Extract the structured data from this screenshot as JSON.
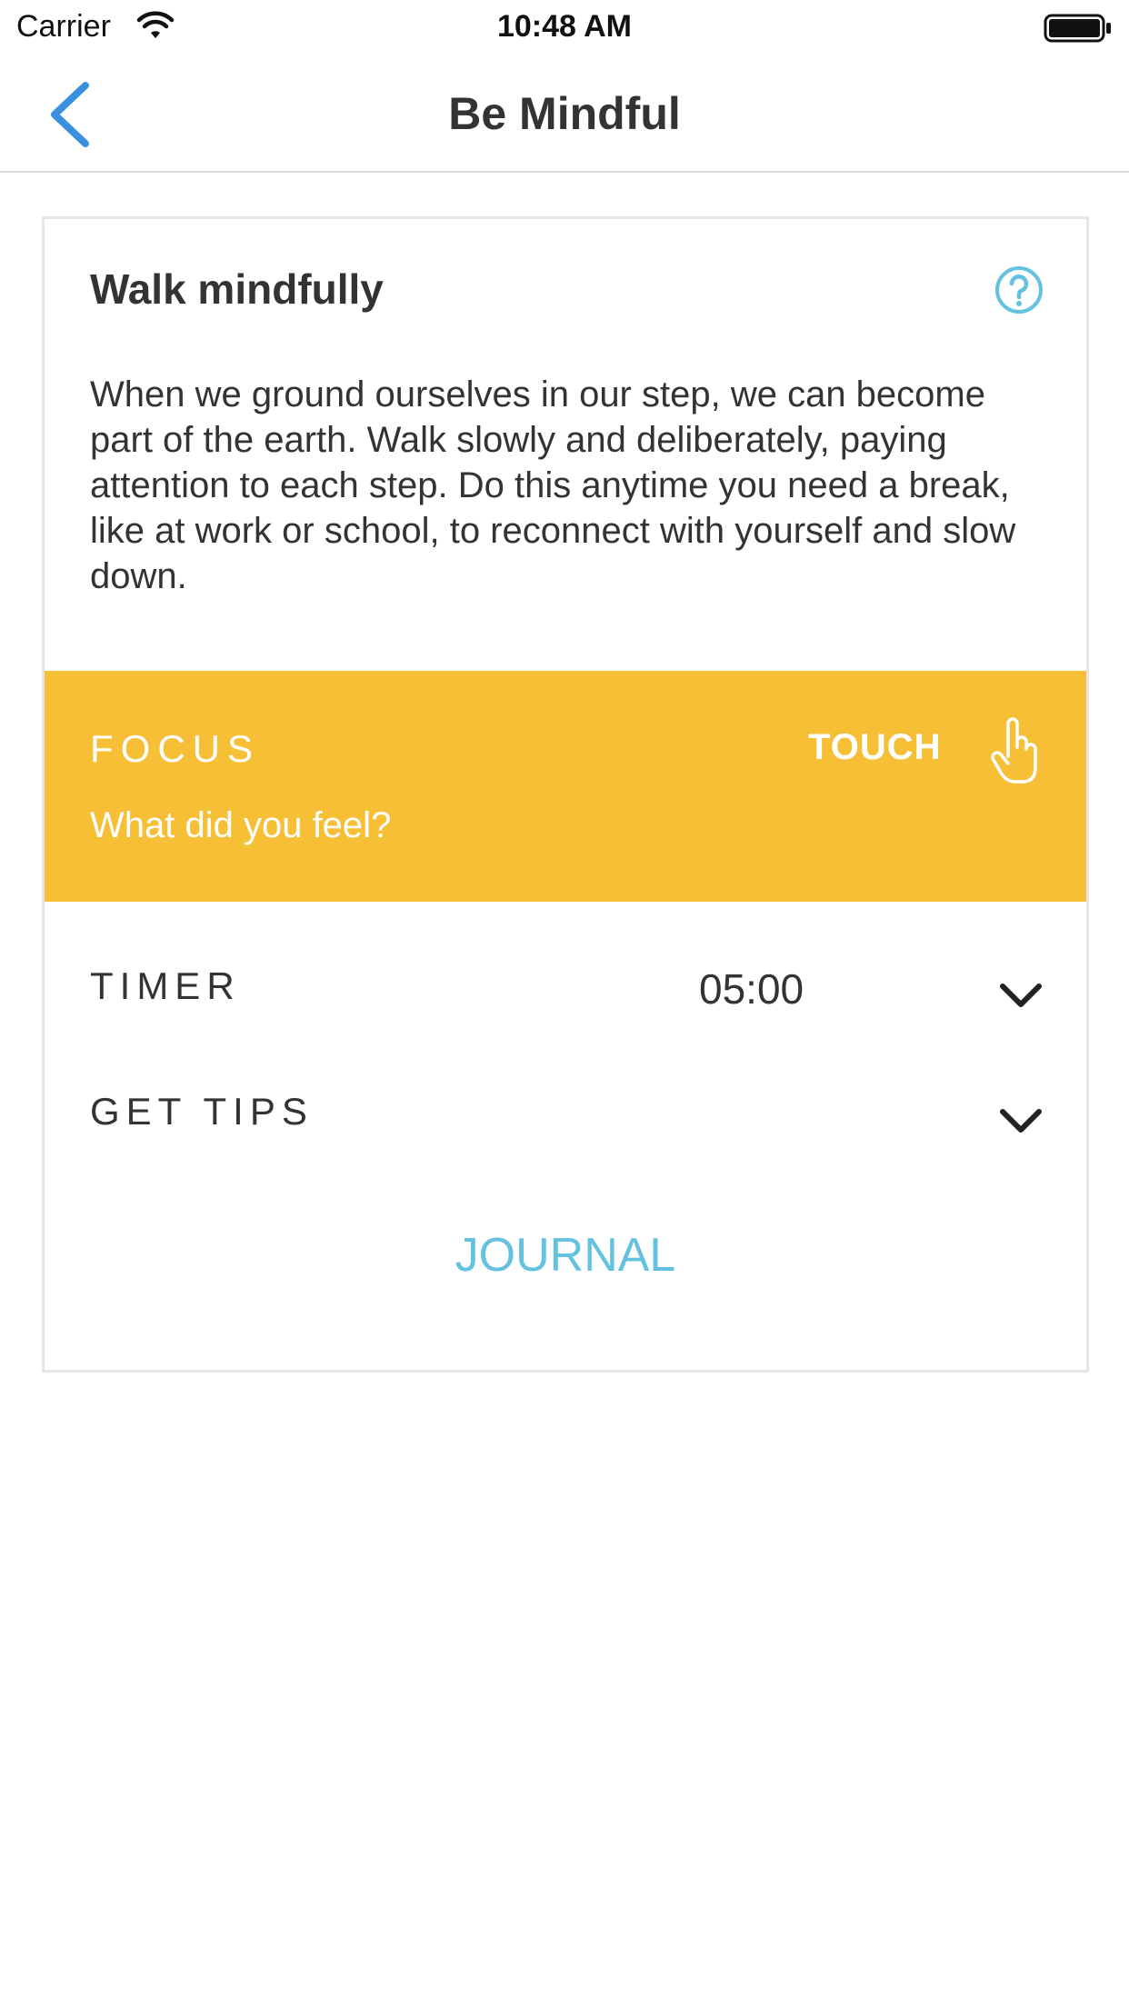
{
  "status_bar": {
    "carrier": "Carrier",
    "time": "10:48 AM"
  },
  "nav": {
    "title": "Be Mindful",
    "back_icon": "chevron-left-icon",
    "accent": "#3a8fde"
  },
  "card": {
    "title": "Walk mindfully",
    "help_icon": "question-circle-icon",
    "description": "When we ground ourselves in our step, we can become part of the earth. Walk slowly and deliberately, paying attention to each step. Do this anytime you need a break, like at work or school, to reconnect with yourself and slow down.",
    "focus": {
      "label": "FOCUS",
      "prompt": "What did you feel?",
      "touch_label": "TOUCH",
      "touch_icon": "hand-pointer-icon",
      "color": "#f7bf36"
    },
    "timer": {
      "label": "TIMER",
      "value": "05:00",
      "icon": "chevron-down-icon"
    },
    "tips": {
      "label": "GET TIPS",
      "icon": "chevron-down-icon"
    },
    "journal_label": "JOURNAL",
    "journal_color": "#64c1e0"
  }
}
